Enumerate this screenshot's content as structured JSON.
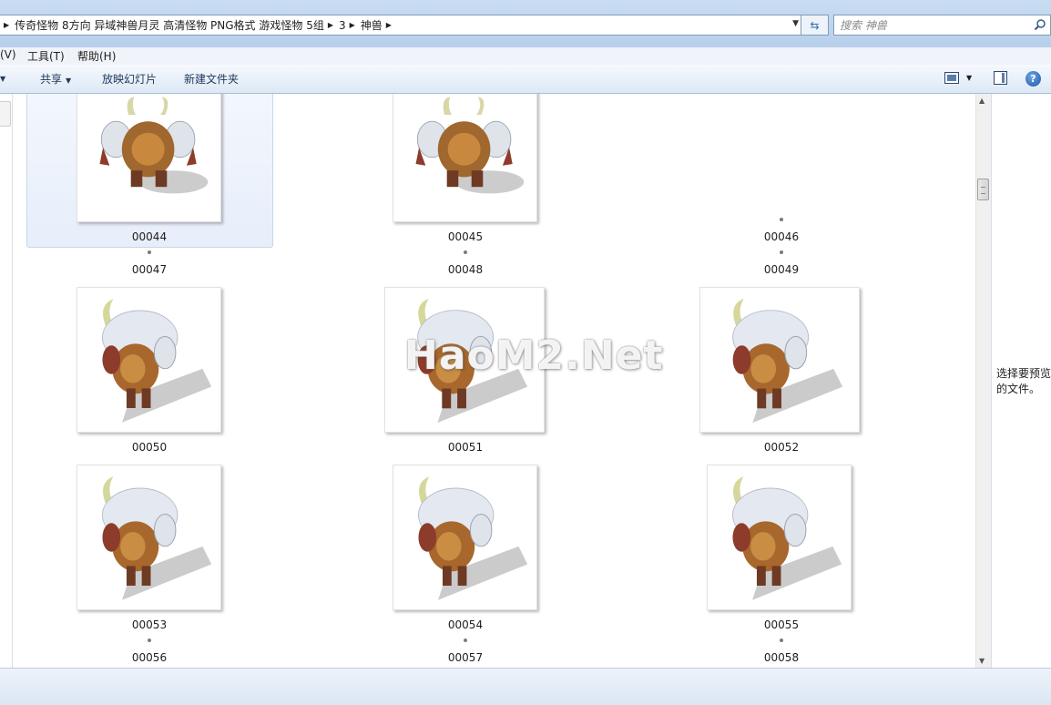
{
  "address_bar": {
    "breadcrumbs": [
      "传奇怪物 8方向 异域神兽月灵 高清怪物 PNG格式 游戏怪物 5组",
      "3",
      "神兽"
    ]
  },
  "search": {
    "placeholder": "搜索 神兽"
  },
  "menu": {
    "items": [
      "(V)",
      "工具(T)",
      "帮助(H)"
    ]
  },
  "toolbar": {
    "share": "共享",
    "slideshow": "放映幻灯片",
    "new_folder": "新建文件夹"
  },
  "files": [
    {
      "name": "00044",
      "thumb": "large",
      "selected": true
    },
    {
      "name": "00045",
      "thumb": "large"
    },
    {
      "name": "00046",
      "thumb": "dot"
    },
    {
      "name": "00047",
      "thumb": "dot"
    },
    {
      "name": "00048",
      "thumb": "dot"
    },
    {
      "name": "00049",
      "thumb": "dot"
    },
    {
      "name": "00050",
      "thumb": "large"
    },
    {
      "name": "00051",
      "thumb": "large"
    },
    {
      "name": "00052",
      "thumb": "large"
    },
    {
      "name": "00053",
      "thumb": "large"
    },
    {
      "name": "00054",
      "thumb": "large"
    },
    {
      "name": "00055",
      "thumb": "large"
    },
    {
      "name": "00056",
      "thumb": "dot"
    },
    {
      "name": "00057",
      "thumb": "dot"
    },
    {
      "name": "00058",
      "thumb": "dot"
    }
  ],
  "watermark": "HaoM2.Net",
  "preview_pane": {
    "message": "选择要预览\n的文件。"
  }
}
